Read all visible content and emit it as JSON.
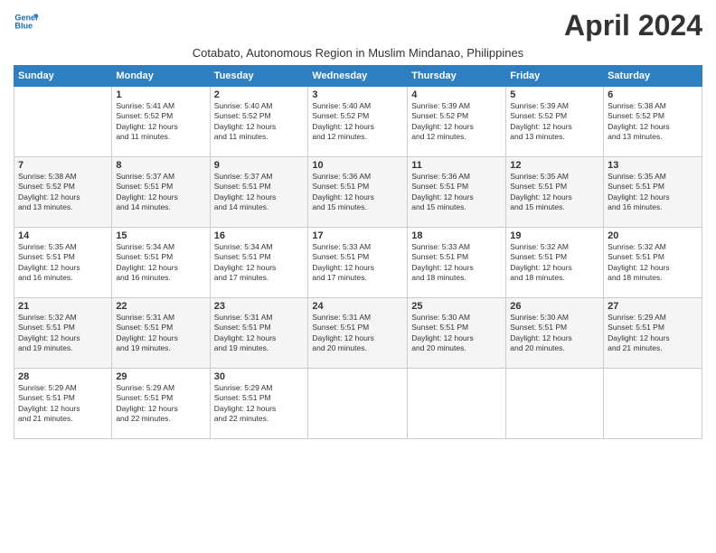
{
  "header": {
    "logo_line1": "General",
    "logo_line2": "Blue",
    "month_title": "April 2024",
    "subtitle": "Cotabato, Autonomous Region in Muslim Mindanao, Philippines"
  },
  "days_of_week": [
    "Sunday",
    "Monday",
    "Tuesday",
    "Wednesday",
    "Thursday",
    "Friday",
    "Saturday"
  ],
  "weeks": [
    [
      {
        "num": "",
        "info": ""
      },
      {
        "num": "1",
        "info": "Sunrise: 5:41 AM\nSunset: 5:52 PM\nDaylight: 12 hours\nand 11 minutes."
      },
      {
        "num": "2",
        "info": "Sunrise: 5:40 AM\nSunset: 5:52 PM\nDaylight: 12 hours\nand 11 minutes."
      },
      {
        "num": "3",
        "info": "Sunrise: 5:40 AM\nSunset: 5:52 PM\nDaylight: 12 hours\nand 12 minutes."
      },
      {
        "num": "4",
        "info": "Sunrise: 5:39 AM\nSunset: 5:52 PM\nDaylight: 12 hours\nand 12 minutes."
      },
      {
        "num": "5",
        "info": "Sunrise: 5:39 AM\nSunset: 5:52 PM\nDaylight: 12 hours\nand 13 minutes."
      },
      {
        "num": "6",
        "info": "Sunrise: 5:38 AM\nSunset: 5:52 PM\nDaylight: 12 hours\nand 13 minutes."
      }
    ],
    [
      {
        "num": "7",
        "info": "Sunrise: 5:38 AM\nSunset: 5:52 PM\nDaylight: 12 hours\nand 13 minutes."
      },
      {
        "num": "8",
        "info": "Sunrise: 5:37 AM\nSunset: 5:51 PM\nDaylight: 12 hours\nand 14 minutes."
      },
      {
        "num": "9",
        "info": "Sunrise: 5:37 AM\nSunset: 5:51 PM\nDaylight: 12 hours\nand 14 minutes."
      },
      {
        "num": "10",
        "info": "Sunrise: 5:36 AM\nSunset: 5:51 PM\nDaylight: 12 hours\nand 15 minutes."
      },
      {
        "num": "11",
        "info": "Sunrise: 5:36 AM\nSunset: 5:51 PM\nDaylight: 12 hours\nand 15 minutes."
      },
      {
        "num": "12",
        "info": "Sunrise: 5:35 AM\nSunset: 5:51 PM\nDaylight: 12 hours\nand 15 minutes."
      },
      {
        "num": "13",
        "info": "Sunrise: 5:35 AM\nSunset: 5:51 PM\nDaylight: 12 hours\nand 16 minutes."
      }
    ],
    [
      {
        "num": "14",
        "info": "Sunrise: 5:35 AM\nSunset: 5:51 PM\nDaylight: 12 hours\nand 16 minutes."
      },
      {
        "num": "15",
        "info": "Sunrise: 5:34 AM\nSunset: 5:51 PM\nDaylight: 12 hours\nand 16 minutes."
      },
      {
        "num": "16",
        "info": "Sunrise: 5:34 AM\nSunset: 5:51 PM\nDaylight: 12 hours\nand 17 minutes."
      },
      {
        "num": "17",
        "info": "Sunrise: 5:33 AM\nSunset: 5:51 PM\nDaylight: 12 hours\nand 17 minutes."
      },
      {
        "num": "18",
        "info": "Sunrise: 5:33 AM\nSunset: 5:51 PM\nDaylight: 12 hours\nand 18 minutes."
      },
      {
        "num": "19",
        "info": "Sunrise: 5:32 AM\nSunset: 5:51 PM\nDaylight: 12 hours\nand 18 minutes."
      },
      {
        "num": "20",
        "info": "Sunrise: 5:32 AM\nSunset: 5:51 PM\nDaylight: 12 hours\nand 18 minutes."
      }
    ],
    [
      {
        "num": "21",
        "info": "Sunrise: 5:32 AM\nSunset: 5:51 PM\nDaylight: 12 hours\nand 19 minutes."
      },
      {
        "num": "22",
        "info": "Sunrise: 5:31 AM\nSunset: 5:51 PM\nDaylight: 12 hours\nand 19 minutes."
      },
      {
        "num": "23",
        "info": "Sunrise: 5:31 AM\nSunset: 5:51 PM\nDaylight: 12 hours\nand 19 minutes."
      },
      {
        "num": "24",
        "info": "Sunrise: 5:31 AM\nSunset: 5:51 PM\nDaylight: 12 hours\nand 20 minutes."
      },
      {
        "num": "25",
        "info": "Sunrise: 5:30 AM\nSunset: 5:51 PM\nDaylight: 12 hours\nand 20 minutes."
      },
      {
        "num": "26",
        "info": "Sunrise: 5:30 AM\nSunset: 5:51 PM\nDaylight: 12 hours\nand 20 minutes."
      },
      {
        "num": "27",
        "info": "Sunrise: 5:29 AM\nSunset: 5:51 PM\nDaylight: 12 hours\nand 21 minutes."
      }
    ],
    [
      {
        "num": "28",
        "info": "Sunrise: 5:29 AM\nSunset: 5:51 PM\nDaylight: 12 hours\nand 21 minutes."
      },
      {
        "num": "29",
        "info": "Sunrise: 5:29 AM\nSunset: 5:51 PM\nDaylight: 12 hours\nand 22 minutes."
      },
      {
        "num": "30",
        "info": "Sunrise: 5:29 AM\nSunset: 5:51 PM\nDaylight: 12 hours\nand 22 minutes."
      },
      {
        "num": "",
        "info": ""
      },
      {
        "num": "",
        "info": ""
      },
      {
        "num": "",
        "info": ""
      },
      {
        "num": "",
        "info": ""
      }
    ]
  ]
}
